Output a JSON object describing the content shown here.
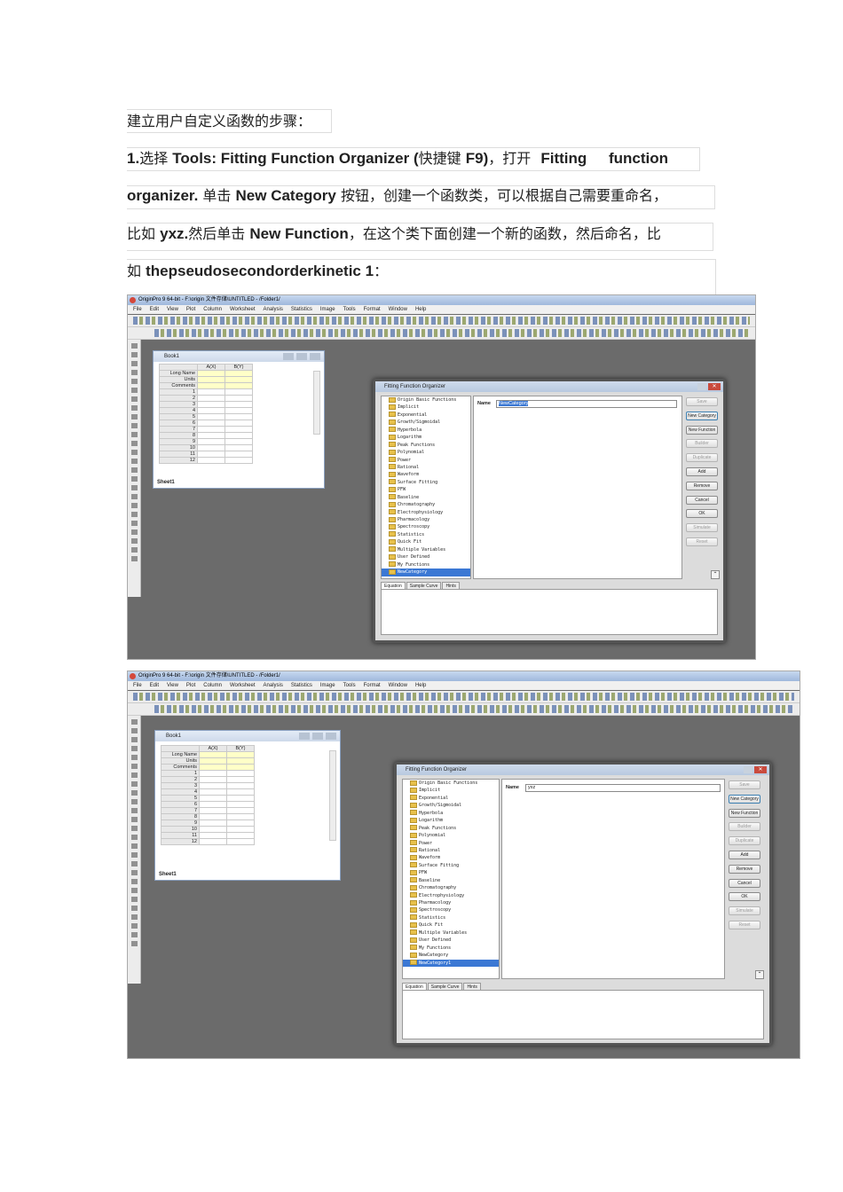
{
  "doc": {
    "heading": "建立用户自定义函数的步骤：",
    "p1a": "1.",
    "p1b": "选择",
    "p1c": "Tools: Fitting Function Organizer (",
    "p1d": "快捷键",
    "p1e": "F9)",
    "p1f": "，打开",
    "p1g": "Fitting function",
    "p2a": "organizer.",
    "p2b": "单击",
    "p2c": "New Category",
    "p2d": "按钮，创建一个函数类，可以根据自己需要重命名，",
    "p3a": "比如",
    "p3b": "yxz.",
    "p3c": "然后单击",
    "p3d": "New Function",
    "p3e": "，在这个类下面创建一个新的函数，然后命名，比",
    "p4a": "如",
    "p4b": "thepseudosecondorderkinetic 1",
    "p4c": "："
  },
  "shot1": {
    "title": "OriginPro 9 64-bit - F:\\origin 文件存储\\UNTITLED - /Folder1/",
    "book_title": "Book1",
    "dialog_title": "Fitting Function Organizer",
    "name_label": "Name",
    "name_value": "NewCategory",
    "sheet_tab": "Sheet1",
    "selected_item": "NewCategory"
  },
  "shot2": {
    "title": "OriginPro 9 64-bit - F:\\origin 文件存储\\UNTITLED - /Folder1/",
    "book_title": "Book1",
    "dialog_title": "Fitting Function Organizer",
    "name_label": "Name",
    "name_value": "yxz",
    "sheet_tab": "Sheet1",
    "selected_item": "NewCategory1"
  },
  "menu": [
    "File",
    "Edit",
    "View",
    "Plot",
    "Column",
    "Worksheet",
    "Analysis",
    "Statistics",
    "Image",
    "Tools",
    "Format",
    "Window",
    "Help"
  ],
  "col_a": "A(X)",
  "col_b": "B(Y)",
  "row_labels": [
    "Long Name",
    "Units",
    "Comments"
  ],
  "row_nums": [
    "1",
    "2",
    "3",
    "4",
    "5",
    "6",
    "7",
    "8",
    "9",
    "10",
    "11",
    "12"
  ],
  "tree1": [
    "Origin Basic Functions",
    "Implicit",
    "Exponential",
    "Growth/Sigmoidal",
    "Hyperbola",
    "Logarithm",
    "Peak Functions",
    "Polynomial",
    "Power",
    "Rational",
    "Waveform",
    "Surface Fitting",
    "PFW",
    "Baseline",
    "Chromatography",
    "Electrophysiology",
    "Pharmacology",
    "Spectroscopy",
    "Statistics",
    "Quick Fit",
    "Multiple Variables",
    "User Defined",
    "My Functions"
  ],
  "tree2": [
    "Origin Basic Functions",
    "Implicit",
    "Exponential",
    "Growth/Sigmoidal",
    "Hyperbola",
    "Logarithm",
    "Peak Functions",
    "Polynomial",
    "Power",
    "Rational",
    "Waveform",
    "Surface Fitting",
    "PFW",
    "Baseline",
    "Chromatography",
    "Electrophysiology",
    "Pharmacology",
    "Spectroscopy",
    "Statistics",
    "Quick Fit",
    "Multiple Variables",
    "User Defined",
    "My Functions",
    "NewCategory"
  ],
  "buttons": [
    "Save",
    "New Category",
    "New Function",
    "Builder",
    "Duplicate",
    "Add",
    "Remove",
    "Cancel",
    "OK",
    "Simulate",
    "Reset"
  ],
  "tabs": [
    "Equation",
    "Sample Curve",
    "Hints"
  ]
}
